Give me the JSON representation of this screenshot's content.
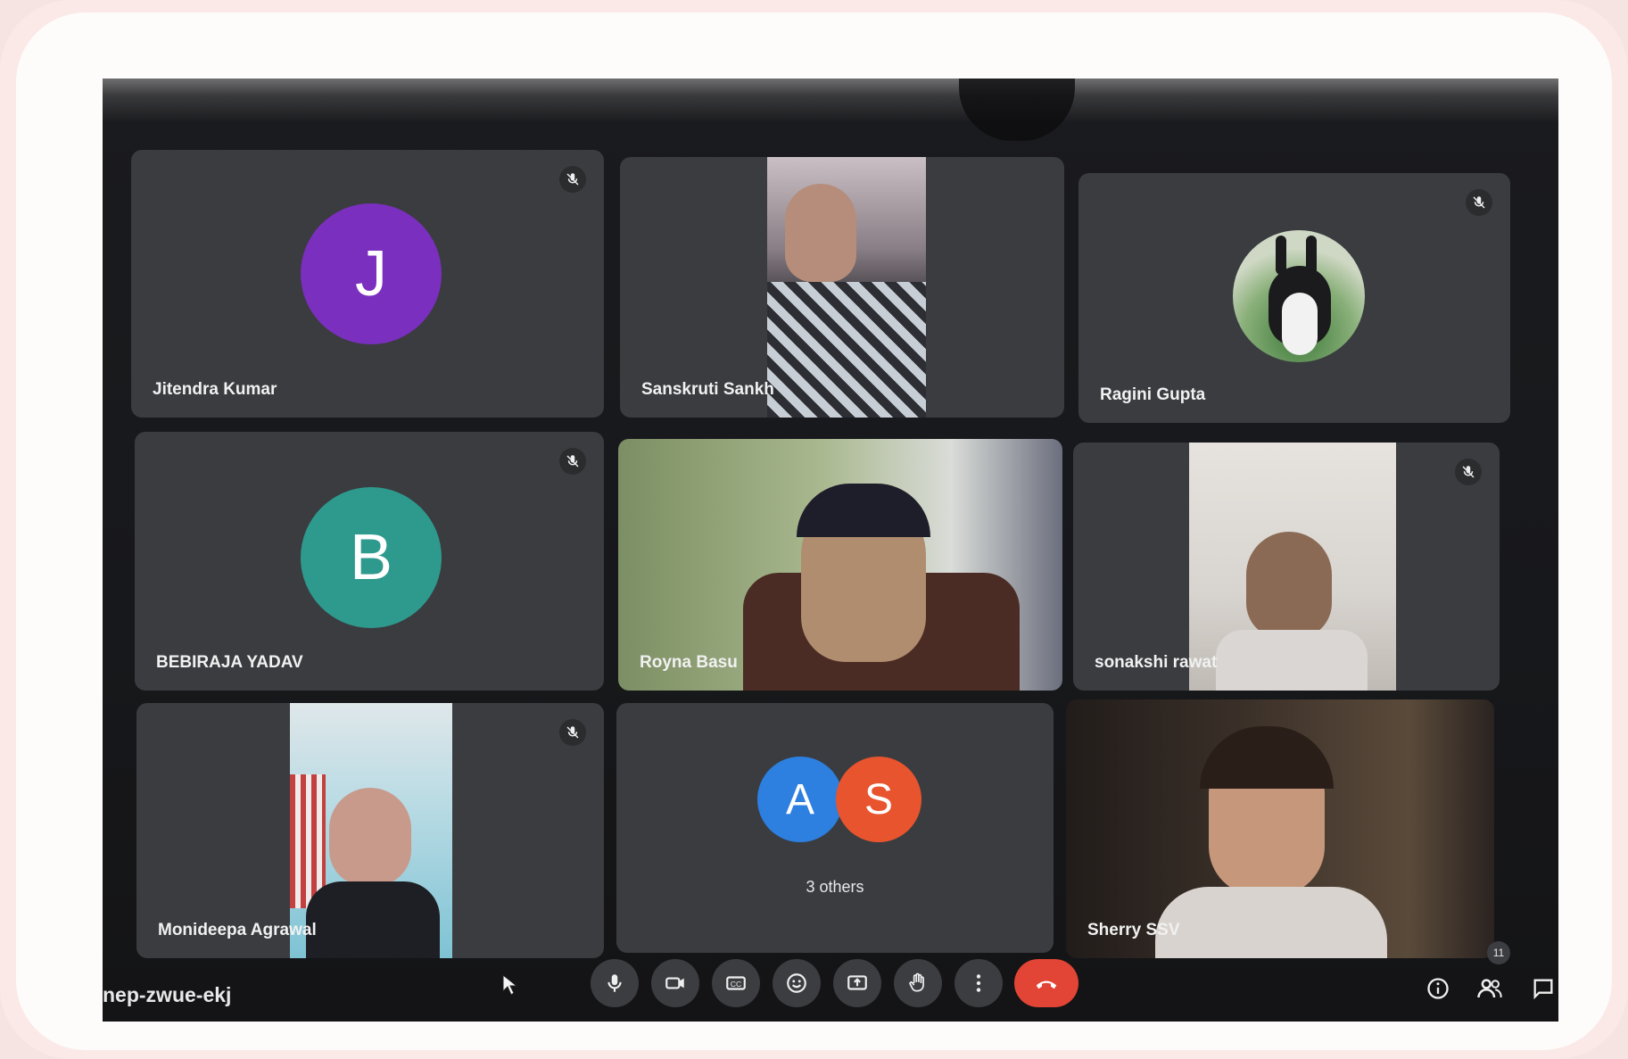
{
  "meeting": {
    "code": "nep-zwue-ekj",
    "participant_count": "11"
  },
  "tiles": {
    "jitendra": {
      "name": "Jitendra Kumar",
      "initial": "J",
      "avatar_color": "#7b2fbe"
    },
    "sanskruti": {
      "name": "Sanskruti Sankh"
    },
    "ragini": {
      "name": "Ragini Gupta"
    },
    "bebiraja": {
      "name": "BEBIRAJA YADAV",
      "initial": "B",
      "avatar_color": "#2e9a8e"
    },
    "royna": {
      "name": "Royna Basu"
    },
    "sonakshi": {
      "name": "sonakshi rawat"
    },
    "monideepa": {
      "name": "Monideepa Agrawal"
    },
    "others": {
      "label": "3 others",
      "initial_a": "A",
      "initial_s": "S",
      "color_a": "#2d7fe0",
      "color_s": "#e8542e"
    },
    "sherry": {
      "name": "Sherry SSV"
    }
  },
  "controls": {
    "icons": [
      "mic-icon",
      "camera-icon",
      "captions-icon",
      "emoji-icon",
      "present-icon",
      "raise-hand-icon",
      "more-icon",
      "leave-call-icon"
    ],
    "right_icons": [
      "info-icon",
      "people-icon",
      "chat-icon"
    ]
  }
}
